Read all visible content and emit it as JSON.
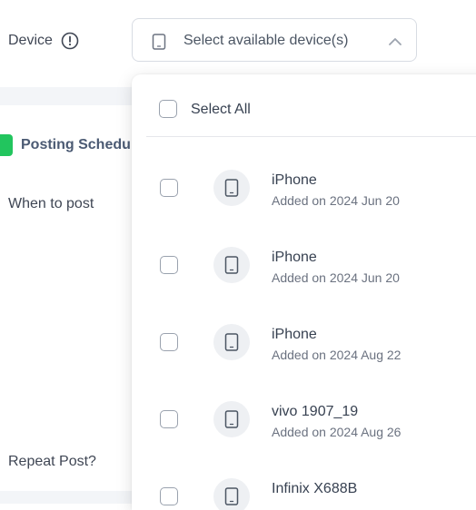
{
  "form": {
    "device_label": "Device",
    "section_title": "Posting Schedul",
    "when_label": "When to post",
    "repeat_label": "Repeat Post?"
  },
  "device_select": {
    "placeholder": "Select available device(s)",
    "expanded": true
  },
  "dropdown": {
    "select_all_label": "Select All",
    "devices": [
      {
        "name": "iPhone",
        "added": "Added on 2024 Jun 20",
        "checked": false
      },
      {
        "name": "iPhone",
        "added": "Added on 2024 Jun 20",
        "checked": false
      },
      {
        "name": "iPhone",
        "added": "Added on 2024 Aug 22",
        "checked": false
      },
      {
        "name": "vivo 1907_19",
        "added": "Added on 2024 Aug 26",
        "checked": false
      },
      {
        "name": "Infinix X688B",
        "added": "",
        "checked": false
      }
    ]
  },
  "colors": {
    "accent_green": "#22c55e",
    "border": "#d8dce3",
    "text_primary": "#374151",
    "text_muted": "#6b7280"
  },
  "icons": {
    "device_info": "exclamation-circle-icon",
    "device_select": "phone-icon",
    "select_toggle": "chevron-up-icon",
    "section": "schedule-icon"
  }
}
